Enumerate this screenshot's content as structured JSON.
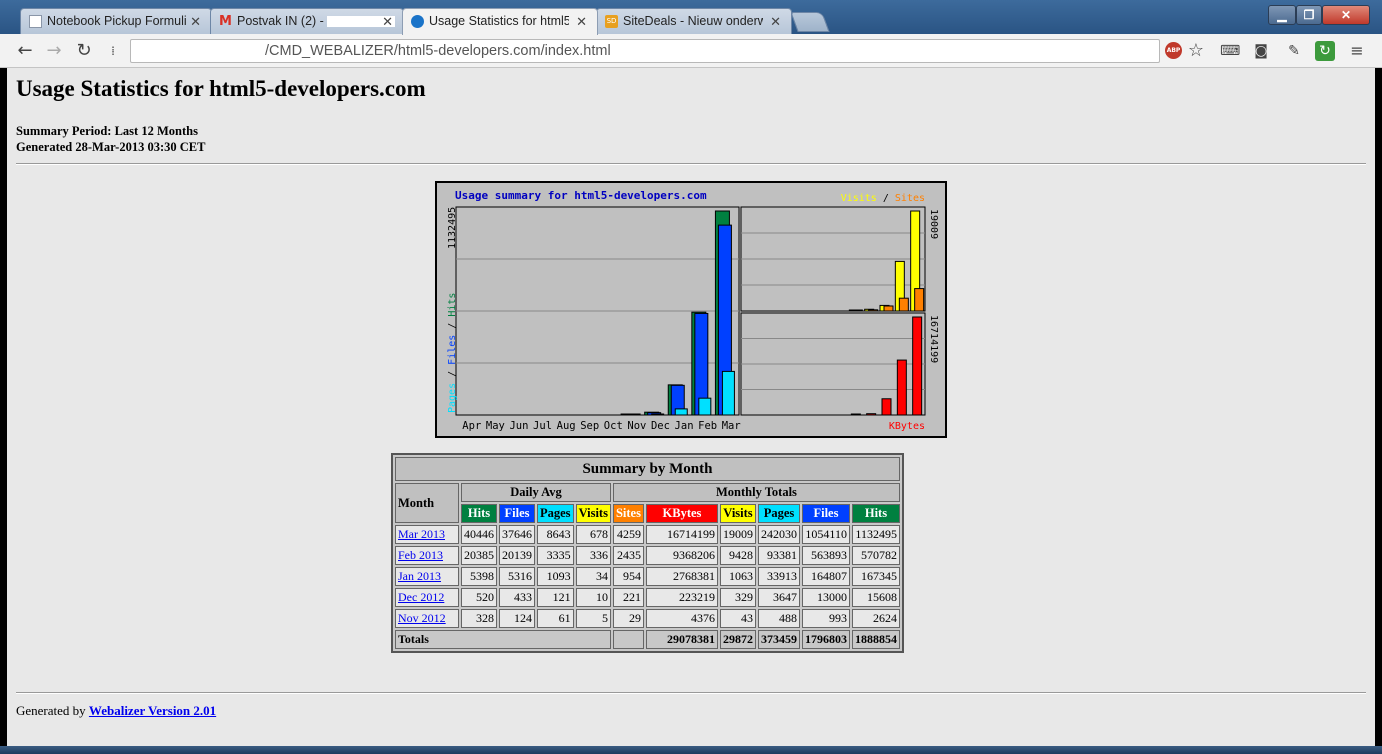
{
  "browser": {
    "tabs": [
      {
        "label": "Notebook Pickup Formuli",
        "icon_color": "#aab6c8",
        "icon": "page-icon"
      },
      {
        "label": "Postvak IN (2) - ",
        "icon_color": "#d93025",
        "icon": "gmail-icon"
      },
      {
        "label": "Usage Statistics for html5-",
        "icon_color": "#1a73c8",
        "icon": "globe-icon",
        "active": true
      },
      {
        "label": "SiteDeals - Nieuw onderw",
        "icon_color": "#e8a020",
        "icon": "sitedeals-icon"
      }
    ],
    "url": "/CMD_WEBALIZER/html5-developers.com/index.html"
  },
  "page": {
    "title": "Usage Statistics for html5-developers.com",
    "summary_period": "Summary Period: Last 12 Months",
    "generated": "Generated 28-Mar-2013 03:30 CET",
    "footer_prefix": "Generated by",
    "footer_link": "Webalizer Version 2.01"
  },
  "colors": {
    "hits": "#008040",
    "files": "#0040ff",
    "pages": "#00e0ff",
    "visits": "#ffff00",
    "sites": "#ff8000",
    "kbytes": "#ff0000"
  },
  "chart_data": {
    "type": "bar",
    "title": "Usage summary for html5-developers.com",
    "categories": [
      "Apr",
      "May",
      "Jun",
      "Jul",
      "Aug",
      "Sep",
      "Oct",
      "Nov",
      "Dec",
      "Jan",
      "Feb",
      "Mar"
    ],
    "left_panel": {
      "ylabel": "Pages / Files / Hits",
      "max_label": "1132495",
      "ymax": 1132495,
      "series": [
        {
          "name": "Hits",
          "values": [
            0,
            0,
            0,
            0,
            0,
            0,
            0,
            2624,
            15608,
            167345,
            570782,
            1132495
          ]
        },
        {
          "name": "Files",
          "values": [
            0,
            0,
            0,
            0,
            0,
            0,
            0,
            993,
            13000,
            164807,
            563893,
            1054110
          ]
        },
        {
          "name": "Pages",
          "values": [
            0,
            0,
            0,
            0,
            0,
            0,
            0,
            488,
            3647,
            33913,
            93381,
            242030
          ]
        }
      ]
    },
    "top_right_panel": {
      "legend": [
        "Visits",
        "Sites"
      ],
      "max_label": "19009",
      "ymax": 19009,
      "series": [
        {
          "name": "Visits",
          "values": [
            0,
            0,
            0,
            0,
            0,
            0,
            0,
            43,
            329,
            1063,
            9428,
            19009
          ]
        },
        {
          "name": "Sites",
          "values": [
            0,
            0,
            0,
            0,
            0,
            0,
            0,
            29,
            221,
            954,
            2435,
            4259
          ]
        }
      ]
    },
    "bottom_right_panel": {
      "legend": [
        "KBytes"
      ],
      "max_label": "16714199",
      "ymax": 16714199,
      "series": [
        {
          "name": "KBytes",
          "values": [
            0,
            0,
            0,
            0,
            0,
            0,
            0,
            4376,
            223219,
            2768381,
            9368206,
            16714199
          ]
        }
      ]
    }
  },
  "table": {
    "title": "Summary by Month",
    "month_header": "Month",
    "daily_avg_header": "Daily Avg",
    "monthly_totals_header": "Monthly Totals",
    "columns": [
      "Hits",
      "Files",
      "Pages",
      "Visits",
      "Sites",
      "KBytes",
      "Visits",
      "Pages",
      "Files",
      "Hits"
    ],
    "rows": [
      {
        "month": "Mar 2013",
        "values": [
          "40446",
          "37646",
          "8643",
          "678",
          "4259",
          "16714199",
          "19009",
          "242030",
          "1054110",
          "1132495"
        ]
      },
      {
        "month": "Feb 2013",
        "values": [
          "20385",
          "20139",
          "3335",
          "336",
          "2435",
          "9368206",
          "9428",
          "93381",
          "563893",
          "570782"
        ]
      },
      {
        "month": "Jan 2013",
        "values": [
          "5398",
          "5316",
          "1093",
          "34",
          "954",
          "2768381",
          "1063",
          "33913",
          "164807",
          "167345"
        ]
      },
      {
        "month": "Dec 2012",
        "values": [
          "520",
          "433",
          "121",
          "10",
          "221",
          "223219",
          "329",
          "3647",
          "13000",
          "15608"
        ]
      },
      {
        "month": "Nov 2012",
        "values": [
          "328",
          "124",
          "61",
          "5",
          "29",
          "4376",
          "43",
          "488",
          "993",
          "2624"
        ]
      }
    ],
    "totals_label": "Totals",
    "totals": [
      "29078381",
      "29872",
      "373459",
      "1796803",
      "1888854"
    ]
  }
}
